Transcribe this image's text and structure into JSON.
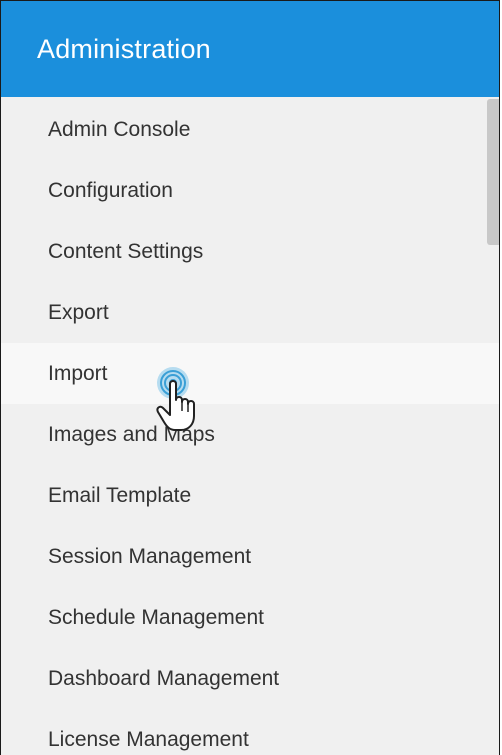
{
  "panel": {
    "title": "Administration",
    "accent_color": "#1b8fdc"
  },
  "menu": {
    "hovered_index": 4,
    "items": [
      {
        "label": "Admin Console"
      },
      {
        "label": "Configuration"
      },
      {
        "label": "Content Settings"
      },
      {
        "label": "Export"
      },
      {
        "label": "Import"
      },
      {
        "label": "Images and Maps"
      },
      {
        "label": "Email Template"
      },
      {
        "label": "Session Management"
      },
      {
        "label": "Schedule Management"
      },
      {
        "label": "Dashboard Management"
      },
      {
        "label": "License Management"
      }
    ]
  },
  "cursor": {
    "icon": "hand-pointer-click-icon"
  }
}
